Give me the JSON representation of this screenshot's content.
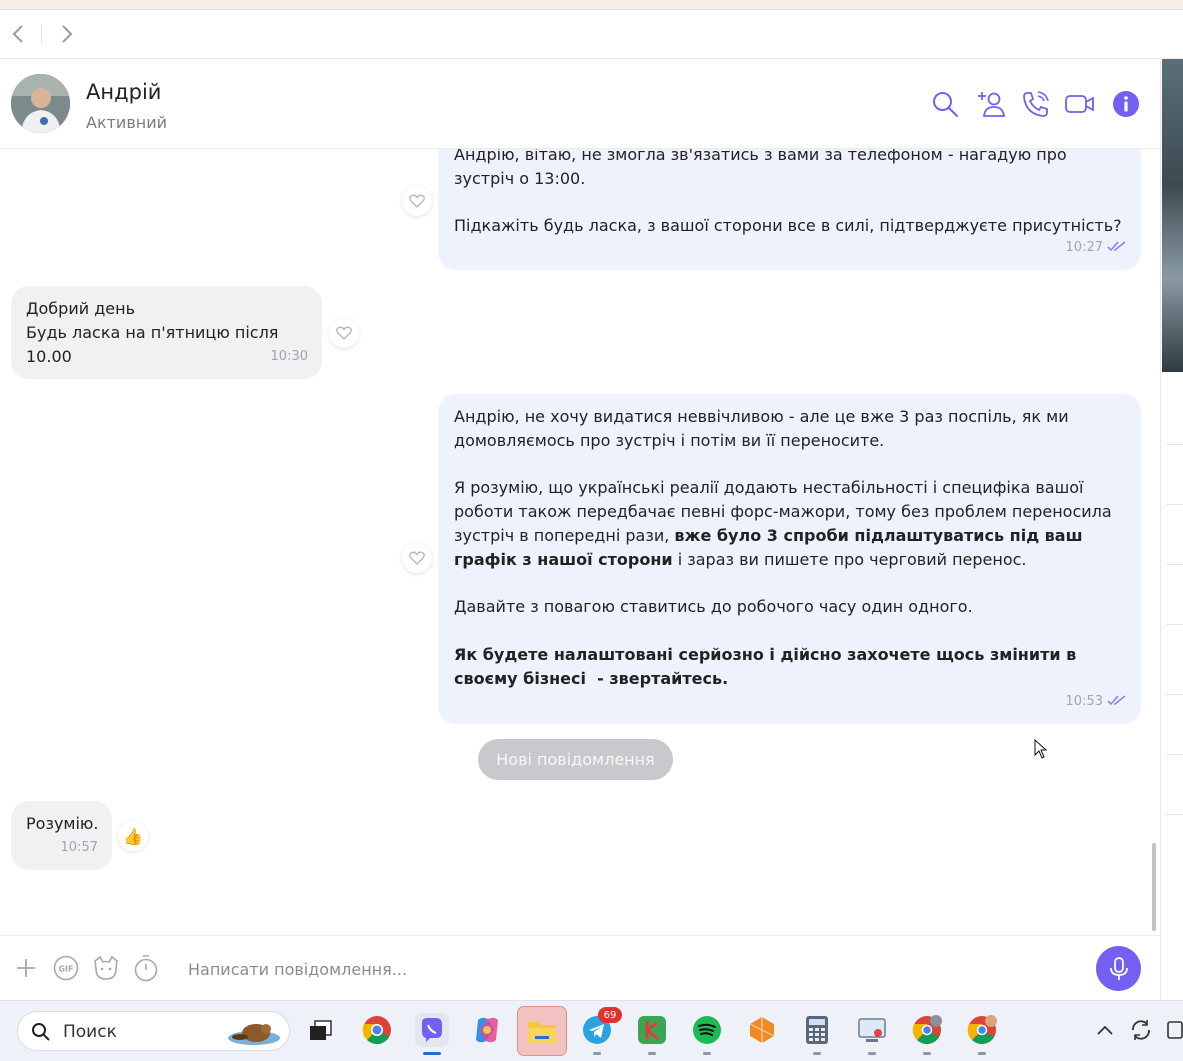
{
  "contact": {
    "name": "Андрій",
    "status": "Активний"
  },
  "messages": {
    "m1": {
      "text": "Андрію, вітаю, не змогла зв'язатись з вами за телефоном - нагадую про зустріч о 13:00.\n\nПідкажіть будь ласка, з вашої сторони все в силі, підтверджуєте присутність?",
      "time": "10:27"
    },
    "m2": {
      "line1": "Добрий день",
      "line2": "Будь ласка на п'ятницю після 10.00",
      "time": "10:30"
    },
    "m3": {
      "p1": "Андрію, не хочу видатися неввічливою - але це вже 3 раз поспіль, як ми домовляємось про зустріч і потім ви її переносите.",
      "p2_start": "Я розумію, що українські реалії додають нестабільності і специфіка вашої роботи також передбачає певні форс-мажори, тому без проблем переносила зустріч в попередні рази, ",
      "p2_bold": "вже було 3 спроби підлаштуватись під ваш графік з нашої сторони",
      "p2_end": " і зараз ви пишете про черговий перенос.",
      "p3": "Давайте з повагою ставитись до робочого часу один одного.",
      "p4": "Як будете налаштовані серйозно і дійсно захочете щось змінити в своєму бізнесі  - звертайтесь.",
      "time": "10:53"
    },
    "m4": {
      "text": "Розумію.",
      "time": "10:57",
      "reaction": "👍"
    }
  },
  "new_messages_label": "Нові повідомлення",
  "composer": {
    "placeholder": "Написати повідомлення..."
  },
  "taskbar": {
    "search_label": "Поиск",
    "telegram_badge": "69"
  },
  "colors": {
    "accent": "#7360f2",
    "outgoing_bubble": "#eef2fd",
    "incoming_bubble": "#f1f1f3"
  },
  "icons": [
    "back-icon",
    "forward-icon",
    "search-icon",
    "add-contact-icon",
    "call-icon",
    "video-call-icon",
    "info-icon",
    "heart-icon",
    "read-ticks-icon",
    "plus-icon",
    "gif-icon",
    "sticker-icon",
    "timer-icon",
    "microphone-icon"
  ]
}
